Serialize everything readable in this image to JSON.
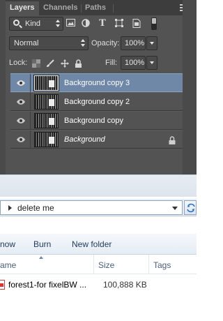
{
  "photoshop": {
    "tabs": [
      {
        "label": "Layers",
        "active": true
      },
      {
        "label": "Channels",
        "active": false
      },
      {
        "label": "Paths",
        "active": false
      }
    ],
    "filter": {
      "kind": "Kind"
    },
    "blend_mode": "Normal",
    "opacity_label": "Opacity:",
    "opacity_value": "100%",
    "lock_label": "Lock:",
    "fill_label": "Fill:",
    "fill_value": "100%",
    "layers": [
      {
        "name": "Background copy 3",
        "selected": true,
        "italic": false,
        "locked": false
      },
      {
        "name": "Background copy 2",
        "selected": false,
        "italic": false,
        "locked": false
      },
      {
        "name": "Background copy",
        "selected": false,
        "italic": false,
        "locked": false
      },
      {
        "name": "Background",
        "selected": false,
        "italic": true,
        "locked": true
      }
    ],
    "colors": {
      "panel": "#535353",
      "selected_row": "#6f88a7"
    }
  },
  "explorer": {
    "address": "delete me",
    "toolbar": [
      "now",
      "Burn",
      "New folder"
    ],
    "columns": [
      "ame",
      "Size",
      "Tags"
    ],
    "file": {
      "name": "forest1-for fixelBW ...",
      "size": "100,888 KB"
    }
  }
}
